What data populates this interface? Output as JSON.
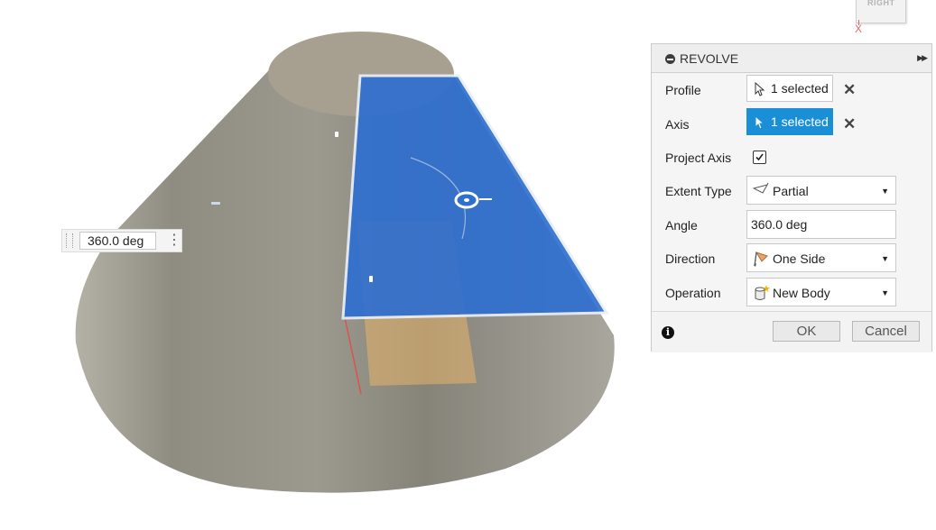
{
  "viewcube": {
    "face_label": "RIGHT",
    "axis_label": "X"
  },
  "angle_float": {
    "value": "360.0 deg"
  },
  "dialog": {
    "title": "REVOLVE",
    "profile": {
      "label": "Profile",
      "value": "1 selected"
    },
    "axis": {
      "label": "Axis",
      "value": "1 selected"
    },
    "project_axis": {
      "label": "Project Axis",
      "checked": true
    },
    "extent_type": {
      "label": "Extent Type",
      "value": "Partial"
    },
    "angle": {
      "label": "Angle",
      "value": "360.0 deg"
    },
    "direction": {
      "label": "Direction",
      "value": "One Side"
    },
    "operation": {
      "label": "Operation",
      "value": "New Body"
    },
    "ok_label": "OK",
    "cancel_label": "Cancel"
  },
  "colors": {
    "accent": "#1b8fd6",
    "profile_plane": "#2f6fd0",
    "cone": "#8f8d83"
  }
}
